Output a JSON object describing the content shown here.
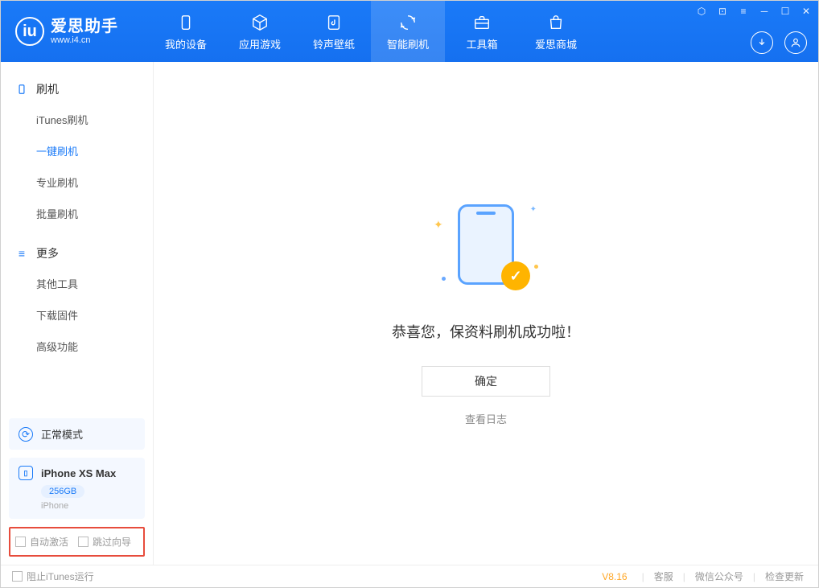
{
  "app": {
    "title": "爱思助手",
    "subtitle": "www.i4.cn"
  },
  "nav": {
    "tabs": [
      {
        "label": "我的设备"
      },
      {
        "label": "应用游戏"
      },
      {
        "label": "铃声壁纸"
      },
      {
        "label": "智能刷机"
      },
      {
        "label": "工具箱"
      },
      {
        "label": "爱思商城"
      }
    ]
  },
  "sidebar": {
    "section1": {
      "title": "刷机",
      "items": [
        "iTunes刷机",
        "一键刷机",
        "专业刷机",
        "批量刷机"
      ]
    },
    "section2": {
      "title": "更多",
      "items": [
        "其他工具",
        "下载固件",
        "高级功能"
      ]
    },
    "mode": "正常模式",
    "device": {
      "name": "iPhone XS Max",
      "storage": "256GB",
      "type": "iPhone"
    },
    "checkboxes": {
      "auto_activate": "自动激活",
      "skip_guide": "跳过向导"
    }
  },
  "main": {
    "success_text": "恭喜您，保资料刷机成功啦！",
    "ok_button": "确定",
    "view_log": "查看日志"
  },
  "footer": {
    "block_itunes": "阻止iTunes运行",
    "version": "V8.16",
    "links": [
      "客服",
      "微信公众号",
      "检查更新"
    ]
  }
}
